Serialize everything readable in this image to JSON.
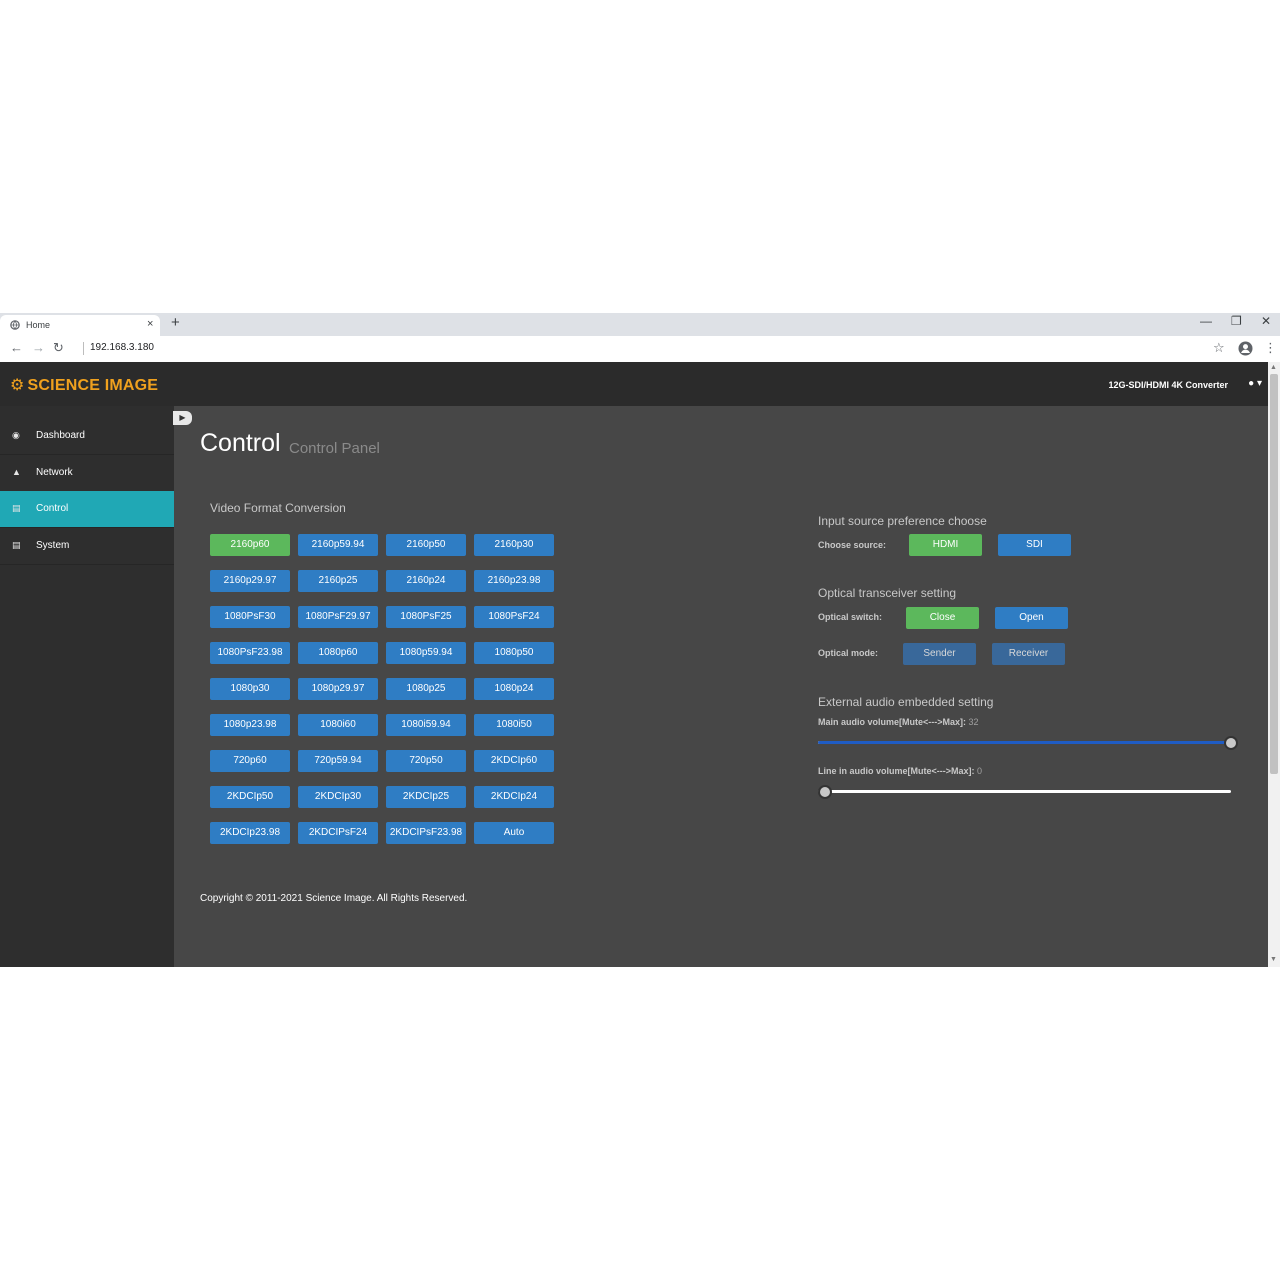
{
  "browser": {
    "tab_title": "Home",
    "tab_close": "×",
    "new_tab": "+",
    "url": "192.168.3.180",
    "win_min": "—",
    "win_restore": "❐",
    "win_close": "✕"
  },
  "header": {
    "brand": "SCIENCE IMAGE",
    "device": "12G-SDI/HDMI 4K Converter"
  },
  "sidebar": {
    "items": [
      {
        "label": "Dashboard",
        "icon": "dashboard-icon"
      },
      {
        "label": "Network",
        "icon": "network-icon"
      },
      {
        "label": "Control",
        "icon": "chart-icon"
      },
      {
        "label": "System",
        "icon": "system-icon"
      }
    ],
    "active": "Control"
  },
  "page": {
    "title": "Control",
    "subtitle": "Control Panel"
  },
  "video_format": {
    "title": "Video Format Conversion",
    "active": "2160p60",
    "formats": [
      "2160p60",
      "2160p59.94",
      "2160p50",
      "2160p30",
      "2160p29.97",
      "2160p25",
      "2160p24",
      "2160p23.98",
      "1080PsF30",
      "1080PsF29.97",
      "1080PsF25",
      "1080PsF24",
      "1080PsF23.98",
      "1080p60",
      "1080p59.94",
      "1080p50",
      "1080p30",
      "1080p29.97",
      "1080p25",
      "1080p24",
      "1080p23.98",
      "1080i60",
      "1080i59.94",
      "1080i50",
      "720p60",
      "720p59.94",
      "720p50",
      "2KDCIp60",
      "2KDCIp50",
      "2KDCIp30",
      "2KDCIp25",
      "2KDCIp24",
      "2KDCIp23.98",
      "2KDCIPsF24",
      "2KDCIPsF23.98",
      "Auto"
    ]
  },
  "input_source": {
    "title": "Input source preference choose",
    "label": "Choose source:",
    "options": [
      "HDMI",
      "SDI"
    ],
    "selected": "HDMI"
  },
  "optical": {
    "title": "Optical transceiver setting",
    "switch_label": "Optical switch:",
    "switch_options": [
      "Close",
      "Open"
    ],
    "switch_selected": "Close",
    "mode_label": "Optical mode:",
    "mode_options": [
      "Sender",
      "Receiver"
    ]
  },
  "audio": {
    "title": "External audio embedded setting",
    "main_label": "Main audio volume[Mute<--->Max]:",
    "main_value": "32",
    "main_level": 1.0,
    "line_label": "Line in audio volume[Mute<--->Max]:",
    "line_value": "0",
    "line_level": 0.0
  },
  "footer": {
    "copyright": "Copyright © 2011-2021 Science Image. All Rights Reserved."
  },
  "colors": {
    "brand": "#f0a11e",
    "active_nav": "#20a8b5",
    "button_blue": "#2f7dc4",
    "button_green": "#5cb85c"
  }
}
